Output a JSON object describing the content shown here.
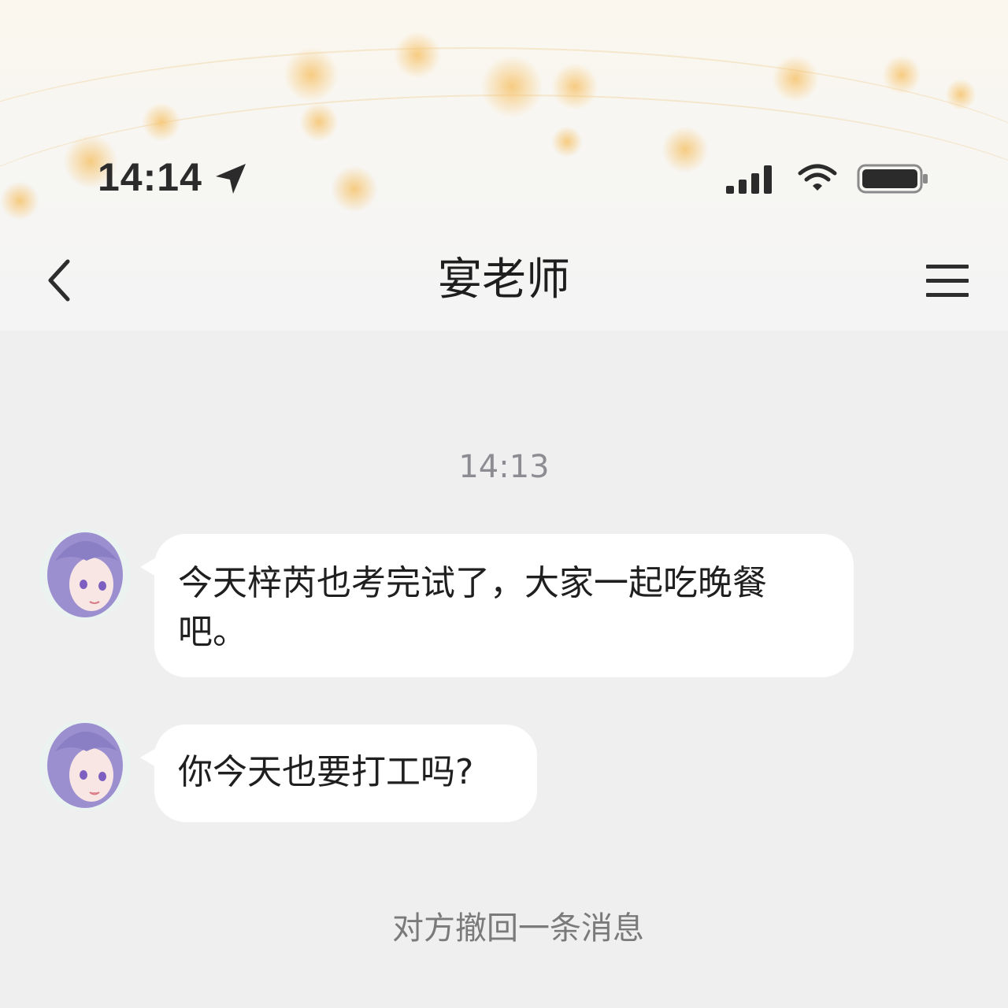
{
  "status_bar": {
    "time": "14:14",
    "icons": [
      "location-arrow-icon",
      "cellular-signal-icon",
      "wifi-icon",
      "battery-icon"
    ]
  },
  "header": {
    "title": "宴老师",
    "back_icon": "chevron-left-icon",
    "menu_icon": "hamburger-menu-icon"
  },
  "chat": {
    "timestamp": "14:13",
    "messages": [
      {
        "sender": "incoming",
        "avatar": "purple-haired-girl-avatar",
        "line1": "今天梓芮也考完试了，大家一起吃晚餐",
        "line2": "吧。"
      },
      {
        "sender": "incoming",
        "avatar": "purple-haired-girl-avatar",
        "text": "你今天也要打工吗?"
      }
    ],
    "system_notice": "对方撤回一条消息"
  },
  "colors": {
    "background": "#efeff0",
    "bubble": "#ffffff",
    "timestamp": "#8c8c92",
    "notice": "#7a7a7a",
    "sparkle": "#f6c46e",
    "avatar_hair": "#9b8fd0"
  }
}
